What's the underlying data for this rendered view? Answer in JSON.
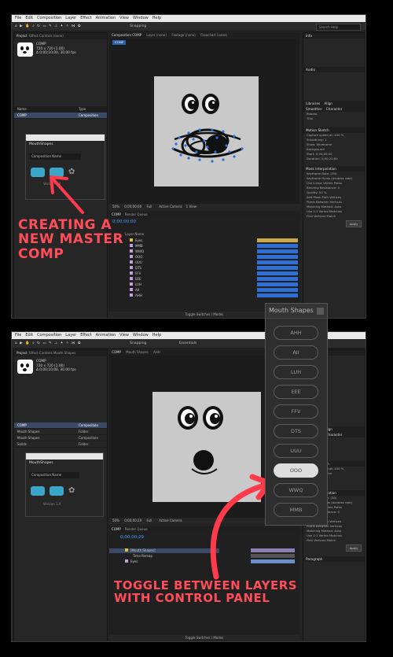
{
  "menu": [
    "File",
    "Edit",
    "Composition",
    "Layer",
    "Effect",
    "Animation",
    "View",
    "Window",
    "Help"
  ],
  "toolbar": {
    "snapping": "Snapping",
    "search": "Search Help",
    "search_bottom": "Essentials"
  },
  "top": {
    "project_tabs": [
      "Project",
      "Effect Controls (none)"
    ],
    "comp_name": "COMP",
    "comp_info": "720 x 720 (1.00)",
    "comp_info2": "Δ 0;00;10;00, 30.00 fps",
    "project_cols": [
      "Name",
      "Type"
    ],
    "project_rows": [
      {
        "name": "COMP",
        "type": "Composition"
      }
    ],
    "viewer_tabs": [
      "Composition COMP",
      "Layer (none)",
      "Footage (none)",
      "Flowchart (none)"
    ],
    "viewer_comp_tab": "COMP",
    "mouthshapes_panel": {
      "title": "MouthShapes",
      "input": "Composition Name",
      "version": "Version 1.0"
    },
    "timeline_tabs": [
      "COMP",
      "Render Queue"
    ],
    "timecode": "0;00;00;00",
    "zoom": "50%",
    "resolution": "Full",
    "camera": "Active Camera",
    "views": "1 View",
    "layer_header": "Layer Name",
    "layers": [
      "Eyes",
      "MMB",
      "WWQ",
      "OOO",
      "UUU",
      "DTS",
      "FFV",
      "EEE",
      "LUH",
      "AII",
      "AHH"
    ],
    "toggle": "Toggle Switches / Modes",
    "right_panels": [
      "Info",
      "Audio",
      "Libraries",
      "Align",
      "Smoother",
      "Character",
      "Motion Sketch",
      "Mask Interpolation",
      "Paragraph"
    ],
    "character": {
      "font": "Roboto",
      "style": "Thin"
    },
    "motion_sketch": [
      "Capture speed at: 100 %",
      "Smoothing: 1",
      "Show: Wireframe",
      "Background",
      "Start: 0;00;00;00",
      "Duration: 0;00;10;00"
    ],
    "mask_interp": [
      "Keyframe Rate: (30)",
      "Keyframe Fields (doubles rate)",
      "Use Linear Vertex Paths",
      "Bending Resistance: 0",
      "Quality: 50 %",
      "Add Mask Path Vertices",
      "Pixels Between Vertices",
      "Matching Method: Auto",
      "Use 1:1 Vertex Matches",
      "First Vertices Match",
      "Apply"
    ]
  },
  "bottom": {
    "project_tabs": [
      "Project",
      "Effect Controls Mouth Shapes"
    ],
    "comp_name": "COMP",
    "comp_info": "720 x 720 (1.00)",
    "comp_info2": "Δ 0;00;10;00, 30.00 fps",
    "project_rows": [
      {
        "name": "COMP",
        "type": "Composition"
      },
      {
        "name": "Mouth Shapes",
        "type": "Folder"
      },
      {
        "name": "Mouth Shapes",
        "type": "Composition"
      },
      {
        "name": "Solids",
        "type": "Folder"
      }
    ],
    "viewer_tabs": [
      "COMP",
      "Mouth Shapes",
      "AHH"
    ],
    "mouthshapes_panel": {
      "title": "MouthShapes",
      "input": "Composition Name",
      "version": "Version 1.0"
    },
    "timeline_tabs": [
      "COMP",
      "Render Queue"
    ],
    "timecode": "0;00;00;29",
    "zoom": "50%",
    "resolution": "Full",
    "camera": "Active Camera",
    "layers": [
      "[Mouth Shapes]",
      "Time Remap",
      "Eyes"
    ],
    "toggle": "Toggle Switches / Modes"
  },
  "annotations": {
    "top_text": "CREATING A\nNEW MASTER\nCOMP",
    "bottom_text": "TOGGLE BETWEEN LAYERS\nWITH CONTROL PANEL"
  },
  "mouth_shapes_panel": {
    "title": "Mouth Shapes",
    "buttons": [
      "AHH",
      "AII",
      "LUH",
      "EEE",
      "FFV",
      "DTS",
      "UUU",
      "OOO",
      "WWQ",
      "MMB"
    ],
    "active": "OOO"
  },
  "colors": {
    "accent_red": "#ff4d5a",
    "panel_bg": "#262626",
    "selection_blue": "#3a4a66",
    "icon_teal": "#3aa6c8",
    "timeline_bar_blue": "#2f6fd6"
  }
}
